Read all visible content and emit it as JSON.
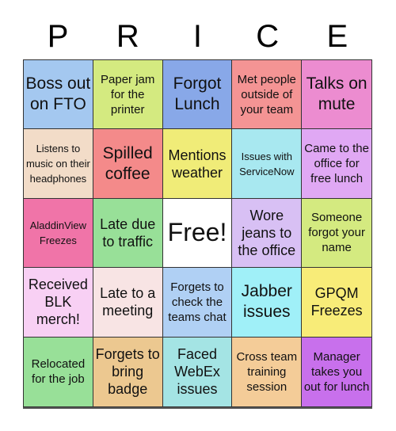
{
  "header": {
    "letters": [
      "P",
      "R",
      "I",
      "C",
      "E"
    ]
  },
  "cells": [
    {
      "text": "Boss out on FTO",
      "color": "#a4c8f0",
      "size": "s-l"
    },
    {
      "text": "Paper jam for the printer",
      "color": "#d4ea80",
      "size": "s-s"
    },
    {
      "text": "Forgot Lunch",
      "color": "#88a8e8",
      "size": "s-l"
    },
    {
      "text": "Met people outside of your team",
      "color": "#f49494",
      "size": "s-s"
    },
    {
      "text": "Talks on mute",
      "color": "#ec8cd0",
      "size": "s-l"
    },
    {
      "text": "Listens to music on their headphones",
      "color": "#f2dcc8",
      "size": "s-xs"
    },
    {
      "text": "Spilled coffee",
      "color": "#f48a8a",
      "size": "s-l"
    },
    {
      "text": "Mentions weather",
      "color": "#f0ec78",
      "size": "s-m"
    },
    {
      "text": "Issues with ServiceNow",
      "color": "#a8e8f0",
      "size": "s-xs"
    },
    {
      "text": "Came to the office for free lunch",
      "color": "#e0a8f4",
      "size": "s-s"
    },
    {
      "text": "AladdinView Freezes",
      "color": "#f074a8",
      "size": "s-xs"
    },
    {
      "text": "Late due to traffic",
      "color": "#98e098",
      "size": "s-m"
    },
    {
      "text": "Free!",
      "color": "#ffffff",
      "size": "free"
    },
    {
      "text": "Wore jeans to the office",
      "color": "#d8c0f4",
      "size": "s-m"
    },
    {
      "text": "Someone forgot your name",
      "color": "#d4ea80",
      "size": "s-s"
    },
    {
      "text": "Received BLK merch!",
      "color": "#f8d0f4",
      "size": "s-m"
    },
    {
      "text": "Late to a meeting",
      "color": "#f8e4e4",
      "size": "s-m"
    },
    {
      "text": "Forgets to check the teams chat",
      "color": "#b0d0f4",
      "size": "s-s"
    },
    {
      "text": "Jabber issues",
      "color": "#a0f0f8",
      "size": "s-l"
    },
    {
      "text": "GPQM Freezes",
      "color": "#f8ec78",
      "size": "s-m"
    },
    {
      "text": "Relocated for the job",
      "color": "#98e098",
      "size": "s-s"
    },
    {
      "text": "Forgets to bring badge",
      "color": "#ecc890",
      "size": "s-m"
    },
    {
      "text": "Faced WebEx issues",
      "color": "#a4e4e4",
      "size": "s-m"
    },
    {
      "text": "Cross team training session",
      "color": "#f4cc98",
      "size": "s-s"
    },
    {
      "text": "Manager takes you out for lunch",
      "color": "#c870ec",
      "size": "s-s"
    }
  ]
}
